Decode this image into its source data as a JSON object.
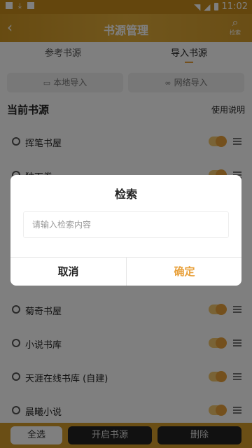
{
  "status_bar": {
    "time": "11:02"
  },
  "app_bar": {
    "title": "书源管理",
    "search_label": "检索",
    "back_icon": "back-arrow-icon"
  },
  "tabs": [
    {
      "label": "参考书源"
    },
    {
      "label": "导入书源"
    }
  ],
  "import": {
    "local": "本地导入",
    "network": "网络导入"
  },
  "section": {
    "title": "当前书源",
    "help": "使用说明"
  },
  "sources": [
    {
      "name": "挥笔书屋",
      "enabled": true
    },
    {
      "name": "独下卷",
      "enabled": true
    },
    {
      "name": "菊奇书屋",
      "enabled": true
    },
    {
      "name": "小说书库",
      "enabled": true
    },
    {
      "name": "天涯在线书库 (自建)",
      "enabled": true
    },
    {
      "name": "晨曦小说",
      "enabled": true
    }
  ],
  "bottom_bar": {
    "select_all": "全选",
    "enable": "开启书源",
    "delete": "删除"
  },
  "dialog": {
    "title": "检索",
    "input_value": "",
    "placeholder": "请输入检索内容",
    "cancel": "取消",
    "confirm": "确定"
  },
  "colors": {
    "accent": "#e8a03a",
    "header": "#d49c2b"
  }
}
